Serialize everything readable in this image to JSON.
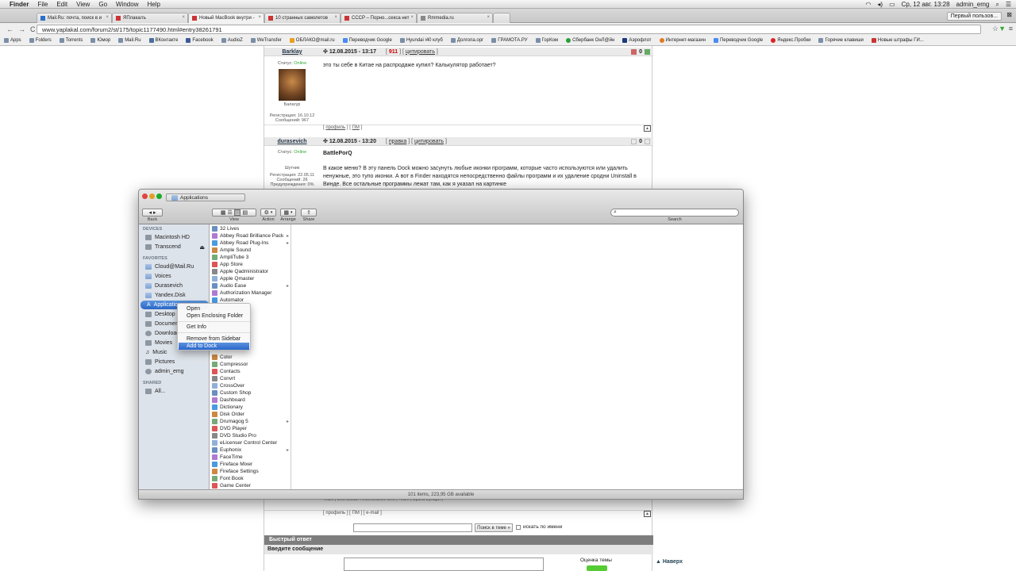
{
  "menubar": {
    "apple": "",
    "app": "Finder",
    "items": [
      "File",
      "Edit",
      "View",
      "Go",
      "Window",
      "Help"
    ],
    "datetime": "Ср, 12 авг. 13:28",
    "user": "admin_emg"
  },
  "browser": {
    "tabs": [
      {
        "label": "Mail.Ru: почта, поиск в и",
        "active": false
      },
      {
        "label": "ЯПлакалъ",
        "active": false
      },
      {
        "label": "Новый MacBook внутри -",
        "active": true
      },
      {
        "label": "10 странных самолетов",
        "active": false
      },
      {
        "label": "СССР – Порно...секса нет",
        "active": false
      },
      {
        "label": "Rmmedia.ru",
        "active": false
      }
    ],
    "profile_label": "Первый пользов...",
    "back": "←",
    "forward": "→",
    "reload": "C",
    "url": "www.yaplakal.com/forum2/st/175/topic1177490.html#entry38261791",
    "bookmarks": [
      "Apps",
      "Folders",
      "Torrents",
      "Юмор",
      "Mail.Ru",
      "ВКонтакте",
      "Facebook",
      "AudioZ",
      "WeTransfer",
      "ОБЛАКО@mail.ru",
      "Переводчик Google",
      "Hyundai i40 клуб",
      "Долгопа.орг",
      "ГРАМОТА.РУ",
      "ГорКом",
      "Сбербанк ОнЛ@йн",
      "Аэрофлот",
      "Интернет-магазин",
      "Переводчик Google",
      "Яндекс.Пробки",
      "Горячие клавиши",
      "Новые штрафы ГИ..."
    ]
  },
  "forum": {
    "post1": {
      "author": "Barklay",
      "date": "12.08.2015 - 13:17",
      "rep": "911",
      "quote": "цитировать",
      "votes": "0",
      "status_label": "Статус:",
      "status": "Online",
      "rank": "Балагур",
      "reg": "Регистрация: 16.10.12",
      "msgs": "Сообщений: 967",
      "text": "это ты себе в Китае на распродаже купил? Калькулятор работает?",
      "profile": "профиль",
      "pm": "ПМ"
    },
    "post2": {
      "author": "durasevich",
      "date": "12.08.2015 - 13:20",
      "edit": "правка",
      "quote": "цитировать",
      "votes": "0",
      "status_label": "Статус:",
      "status": "Online",
      "rank": "Шутник",
      "reg": "Регистрация: 22.05.11",
      "msgs": "Сообщений: 26",
      "warn": "Предупреждения: 0%",
      "quote_name": "BattlePorQ",
      "text": "В какое меню? В эту панель Dock можно засунуть любые иконки программ, которые часто используются или удалить ненужные, это тупо иконки. А вот в Finder находятся непосредственно файлы программ и их удаление сродни Uninstall в Винде. Все остальные программы лежат там, как я указал на картинке"
    },
    "bottom": {
      "team_line": "Team | Военкомат Алкогольное Зло | Team | Брата Бухари |",
      "links": "[ профиль ] [ ПМ ] [ e-mail ]",
      "search_btn": "Поиск в теме »",
      "search_by_name": "искать по имени",
      "quick_reply": "Быстрый ответ",
      "enter_message": "Введите сообщение",
      "rate_topic": "Оценка темы",
      "up": "Наверх"
    }
  },
  "finder": {
    "title": "Applications",
    "toolbar": {
      "back": "Back",
      "view": "View",
      "action": "Action",
      "arrange": "Arrange",
      "share": "Share",
      "search": "Search"
    },
    "sidebar": {
      "devices_header": "DEVICES",
      "devices": [
        "Macintosh HD",
        "Transcend"
      ],
      "favorites_header": "FAVORITES",
      "favorites": [
        "Cloud@Mail.Ru",
        "Voices",
        "Durasevich",
        "Yandex.Disk",
        "Applications",
        "Desktop",
        "Documents",
        "Downloads",
        "Movies",
        "Music",
        "Pictures",
        "admin_emg"
      ],
      "shared_header": "SHARED",
      "shared": [
        "All..."
      ]
    },
    "files_top": [
      "32 Lives",
      "Abbey Road Brilliance Pack",
      "Abbey Road Plug-Ins",
      "Ample Sound",
      "AmpliTube 3",
      "App Store",
      "Apple Qadministrator",
      "Apple Qmaster",
      "Audio Ease",
      "Authorization Manager",
      "Automator"
    ],
    "files_bottom": [
      "Color",
      "Compressor",
      "Contacts",
      "Convrt",
      "CrossOver",
      "Custom Shop",
      "Dashboard",
      "Dictionary",
      "Disk Order",
      "Drumagog 5",
      "DVD Player",
      "DVD Studio Pro",
      "eLicenser Control Center",
      "Euphonix",
      "FaceTime",
      "Fireface Mixer",
      "Fireface Settings",
      "Font Book",
      "Game Center"
    ],
    "status": "101 items, 223,95 GB available"
  },
  "context_menu": {
    "items": [
      "Open",
      "Open Enclosing Folder",
      "Get Info",
      "Remove from Sidebar",
      "Add to Dock"
    ],
    "highlighted": "Add to Dock"
  }
}
